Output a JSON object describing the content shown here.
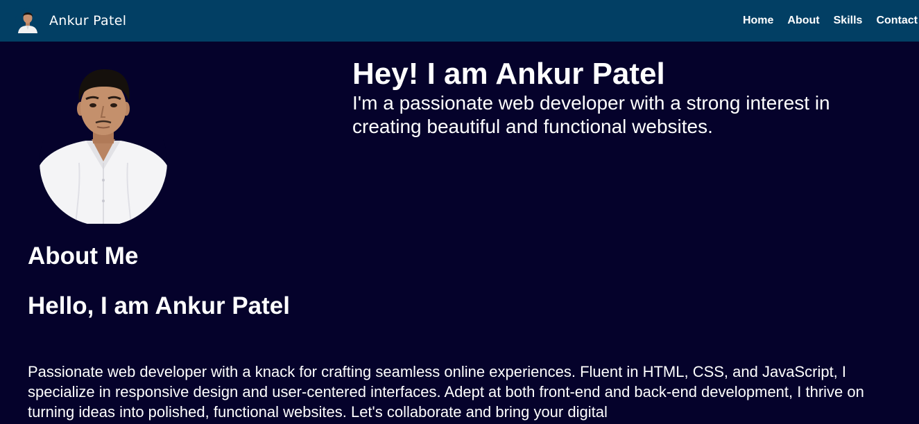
{
  "navbar": {
    "brand_name": "Ankur Patel",
    "links": [
      "Home",
      "About",
      "Skills",
      "Contact"
    ]
  },
  "hero": {
    "title": "Hey! I am Ankur Patel",
    "subtitle": "I'm a passionate web developer with a strong interest in creating beautiful and functional websites."
  },
  "about": {
    "heading": "About Me",
    "greeting": "Hello, I am Ankur Patel",
    "description": "Passionate web developer with a knack for crafting seamless online experiences. Fluent in HTML, CSS, and JavaScript, I specialize in responsive design and user-centered interfaces. Adept at both front-end and back-end development, I thrive on turning ideas into polished, functional websites. Let's collaborate and bring your digital"
  },
  "colors": {
    "navbar_bg": "#023f64",
    "page_bg": "#05022b",
    "text": "#ffffff"
  }
}
